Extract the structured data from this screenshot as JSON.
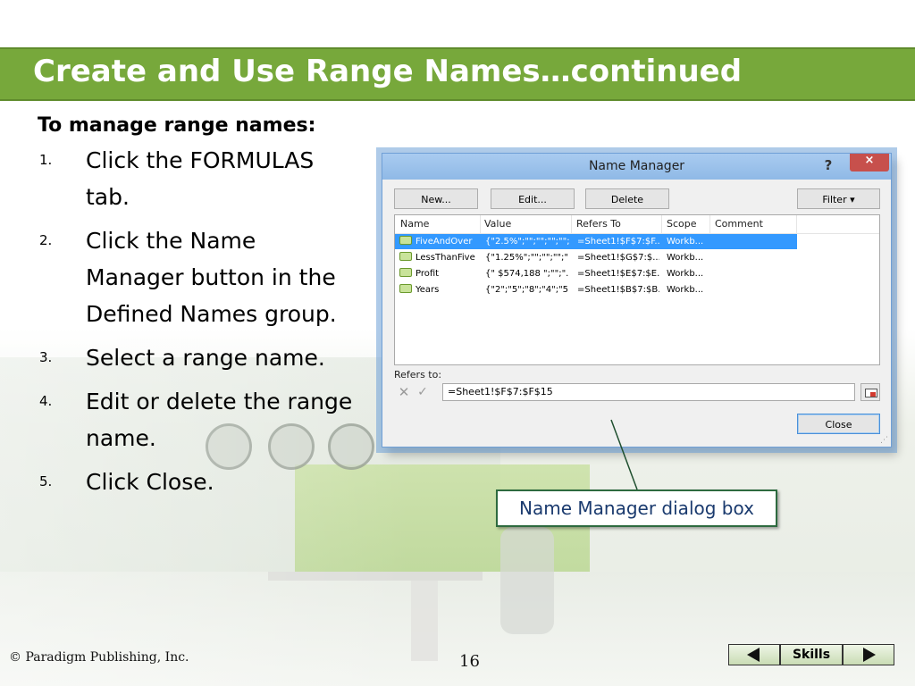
{
  "slide": {
    "title": "Create and Use Range Names…continued",
    "lead": "To manage range names:",
    "steps": [
      {
        "num": "1.",
        "text": "Click the FORMULAS tab."
      },
      {
        "num": "2.",
        "text": "Click the Name Manager button in the Defined Names group."
      },
      {
        "num": "3.",
        "text": "Select a range name."
      },
      {
        "num": "4.",
        "text": "Edit or delete the range name."
      },
      {
        "num": "5.",
        "text": "Click Close."
      }
    ],
    "callout": "Name Manager dialog box",
    "copyright": "© Paradigm Publishing, Inc.",
    "page_number": "16",
    "skills_label": "Skills"
  },
  "dialog": {
    "title": "Name Manager",
    "help_glyph": "?",
    "close_glyph": "×",
    "buttons": {
      "new": "New...",
      "edit": "Edit...",
      "delete": "Delete",
      "filter": "Filter ▾",
      "close": "Close"
    },
    "columns": [
      "Name",
      "Value",
      "Refers To",
      "Scope",
      "Comment"
    ],
    "rows": [
      {
        "name": "FiveAndOver",
        "value": "{\"2.5%\";\"\";\"\";\"\";\"\";...",
        "refers_to": "=Sheet1!$F$7:$F...",
        "scope": "Workb...",
        "comment": "",
        "selected": true
      },
      {
        "name": "LessThanFive",
        "value": "{\"1.25%\";\"\";\"\";\"\";\"...",
        "refers_to": "=Sheet1!$G$7:$...",
        "scope": "Workb...",
        "comment": "",
        "selected": false
      },
      {
        "name": "Profit",
        "value": "{\" $574,188 \";\"\";\"...",
        "refers_to": "=Sheet1!$E$7:$E...",
        "scope": "Workb...",
        "comment": "",
        "selected": false
      },
      {
        "name": "Years",
        "value": "{\"2\";\"5\";\"8\";\"4\";\"5...",
        "refers_to": "=Sheet1!$B$7:$B...",
        "scope": "Workb...",
        "comment": "",
        "selected": false
      }
    ],
    "refers_to_label": "Refers to:",
    "refers_to_value": "=Sheet1!$F$7:$F$15",
    "cancel_glyph": "✕",
    "confirm_glyph": "✓"
  },
  "colors": {
    "title_bar": "#77a83b",
    "selection": "#3399ff",
    "callout_border": "#2d6a3f",
    "callout_text": "#1a3a6e",
    "close_button": "#c7504c"
  }
}
